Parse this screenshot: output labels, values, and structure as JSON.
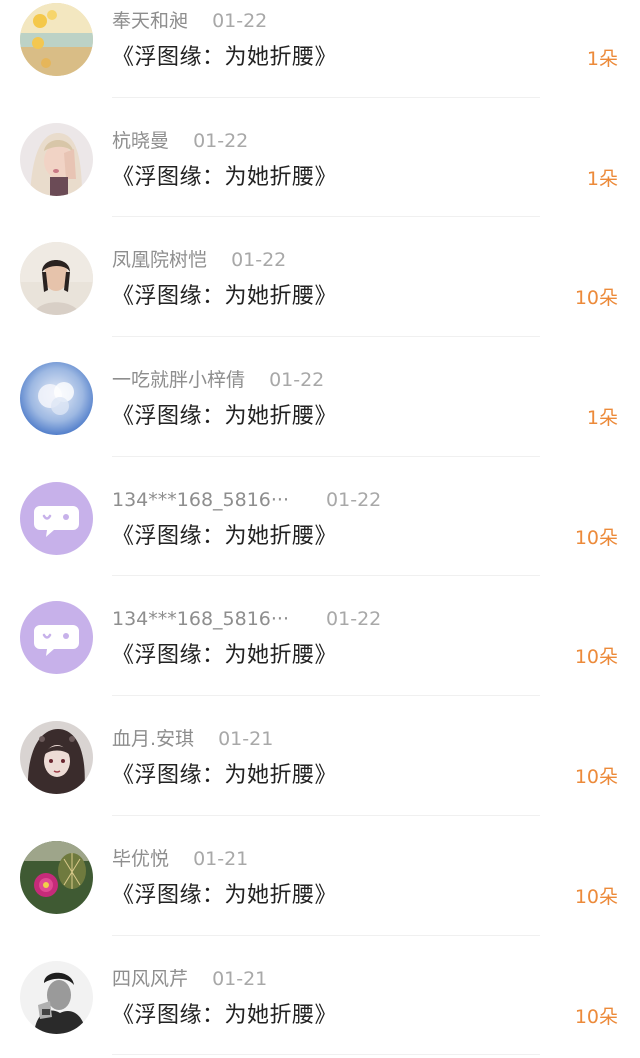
{
  "colors": {
    "amount": "#ec8a3a",
    "name": "#8e8e8e",
    "title": "#222222",
    "default_avatar_bg": "#c7b1ea"
  },
  "items": [
    {
      "user": "奉天和昶",
      "date": "01-22",
      "title": "《浮图缘：为她折腰》",
      "amount": "1朵",
      "avatar": "beach-photo"
    },
    {
      "user": "杭晓曼",
      "date": "01-22",
      "title": "《浮图缘：为她折腰》",
      "amount": "1朵",
      "avatar": "woman-portrait"
    },
    {
      "user": "凤凰院树恺",
      "date": "01-22",
      "title": "《浮图缘：为她折腰》",
      "amount": "10朵",
      "avatar": "person-photo"
    },
    {
      "user": "一吃就胖小梓倩",
      "date": "01-22",
      "title": "《浮图缘：为她折腰》",
      "amount": "1朵",
      "avatar": "sky-clouds"
    },
    {
      "user": "134***168_5816···",
      "date": "01-22",
      "title": "《浮图缘：为她折腰》",
      "amount": "10朵",
      "avatar": "default-chat"
    },
    {
      "user": "134***168_5816···",
      "date": "01-22",
      "title": "《浮图缘：为她折腰》",
      "amount": "10朵",
      "avatar": "default-chat"
    },
    {
      "user": "血月.安琪",
      "date": "01-21",
      "title": "《浮图缘：为她折腰》",
      "amount": "10朵",
      "avatar": "anime-girl"
    },
    {
      "user": "毕优悦",
      "date": "01-21",
      "title": "《浮图缘：为她折腰》",
      "amount": "10朵",
      "avatar": "cactus-flower"
    },
    {
      "user": "四风风芹",
      "date": "01-21",
      "title": "《浮图缘：为她折腰》",
      "amount": "10朵",
      "avatar": "man-portrait"
    }
  ]
}
